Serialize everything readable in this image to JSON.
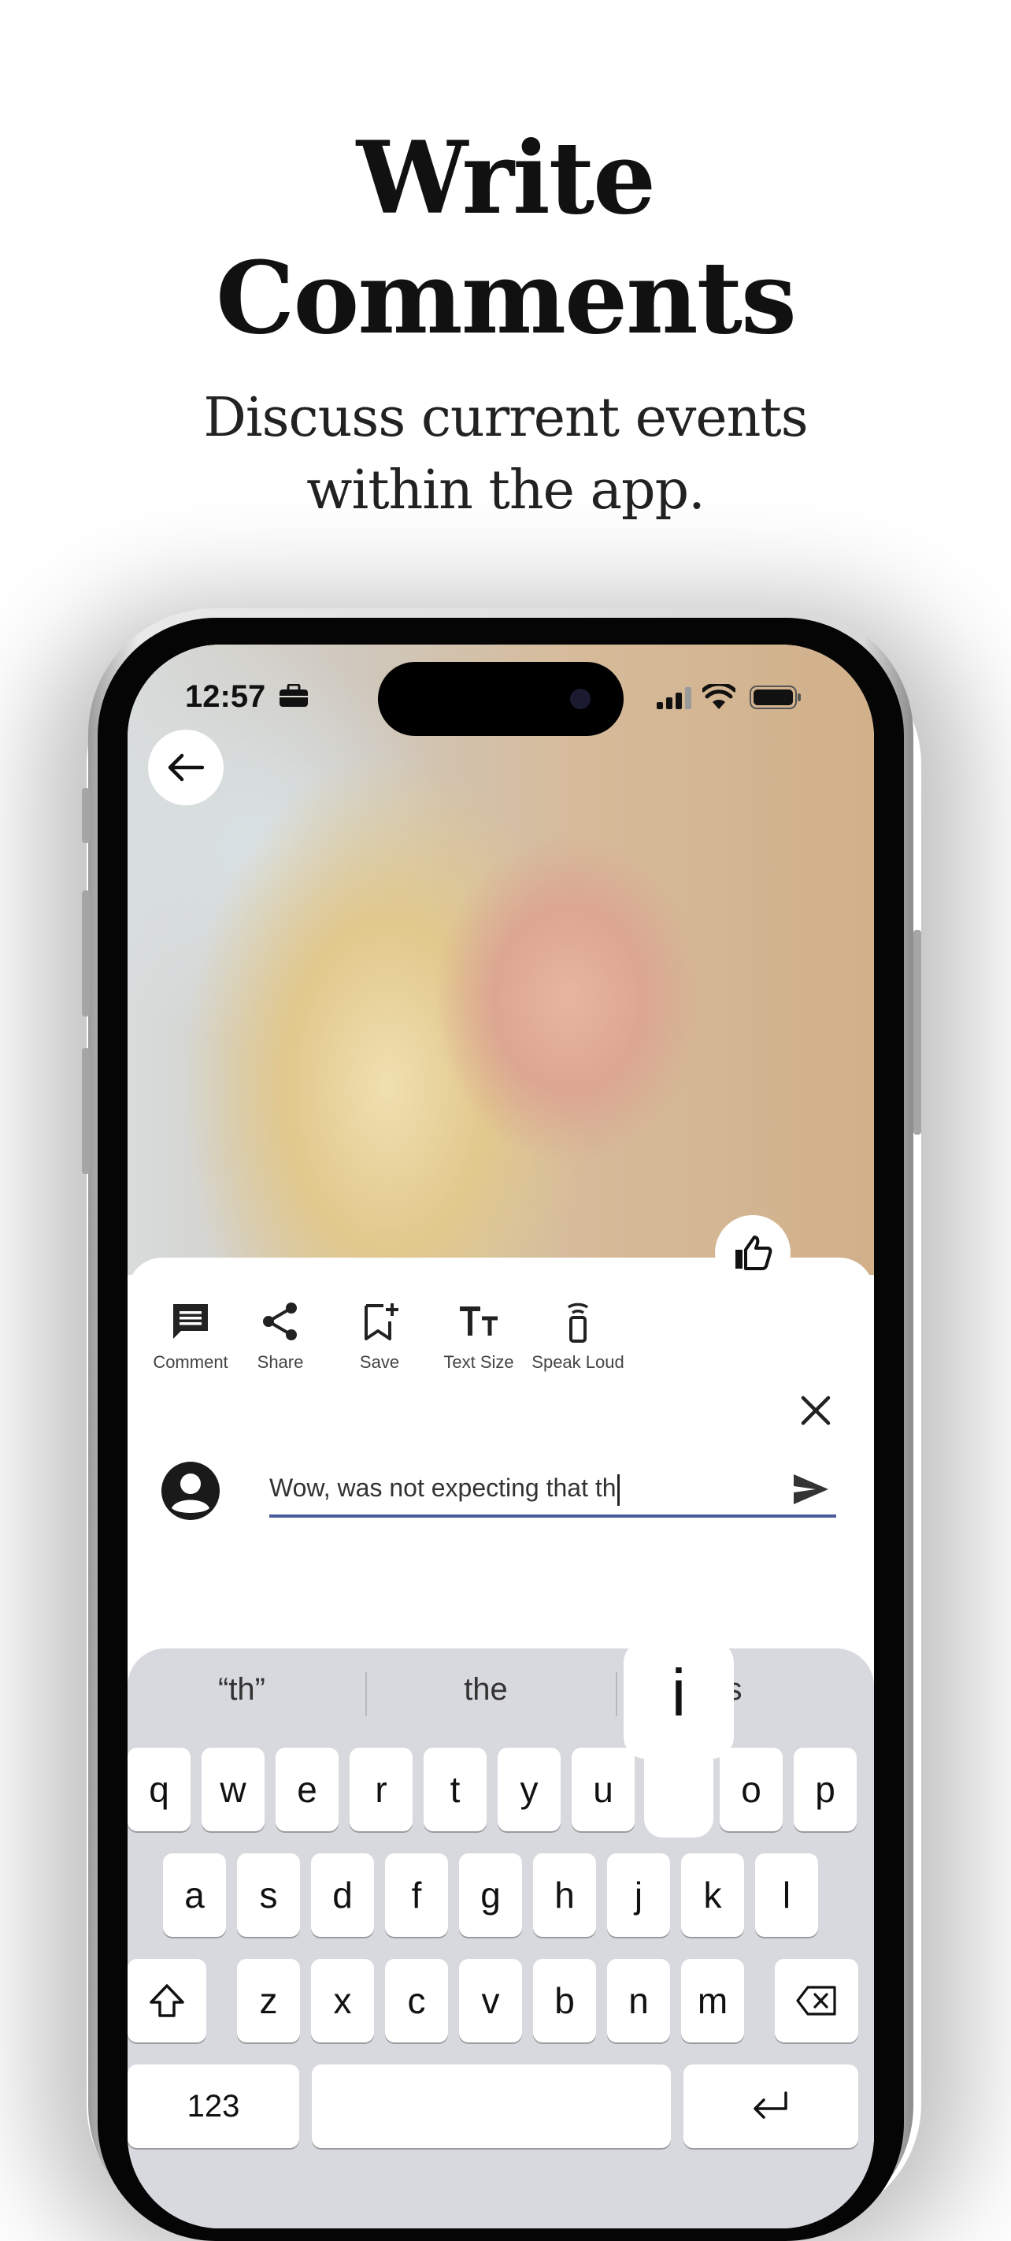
{
  "promo": {
    "title_line1": "Write",
    "title_line2": "Comments",
    "subtitle_line1": "Discuss current events",
    "subtitle_line2": "within the app."
  },
  "status_bar": {
    "time": "12:57"
  },
  "toolbar": {
    "comment_label": "Comment",
    "share_label": "Share",
    "save_label": "Save",
    "text_size_label": "Text Size",
    "speak_loud_label": "Speak Loud"
  },
  "comment": {
    "value": "Wow, was not expecting that th"
  },
  "keyboard": {
    "suggestions": [
      "“th”",
      "the",
      "his"
    ],
    "popup_key": "i",
    "row1": [
      "q",
      "w",
      "e",
      "r",
      "t",
      "y",
      "u",
      "i",
      "o",
      "p"
    ],
    "row2": [
      "a",
      "s",
      "d",
      "f",
      "g",
      "h",
      "j",
      "k",
      "l"
    ],
    "row3": [
      "z",
      "x",
      "c",
      "v",
      "b",
      "n",
      "m"
    ],
    "numbers_label": "123"
  }
}
